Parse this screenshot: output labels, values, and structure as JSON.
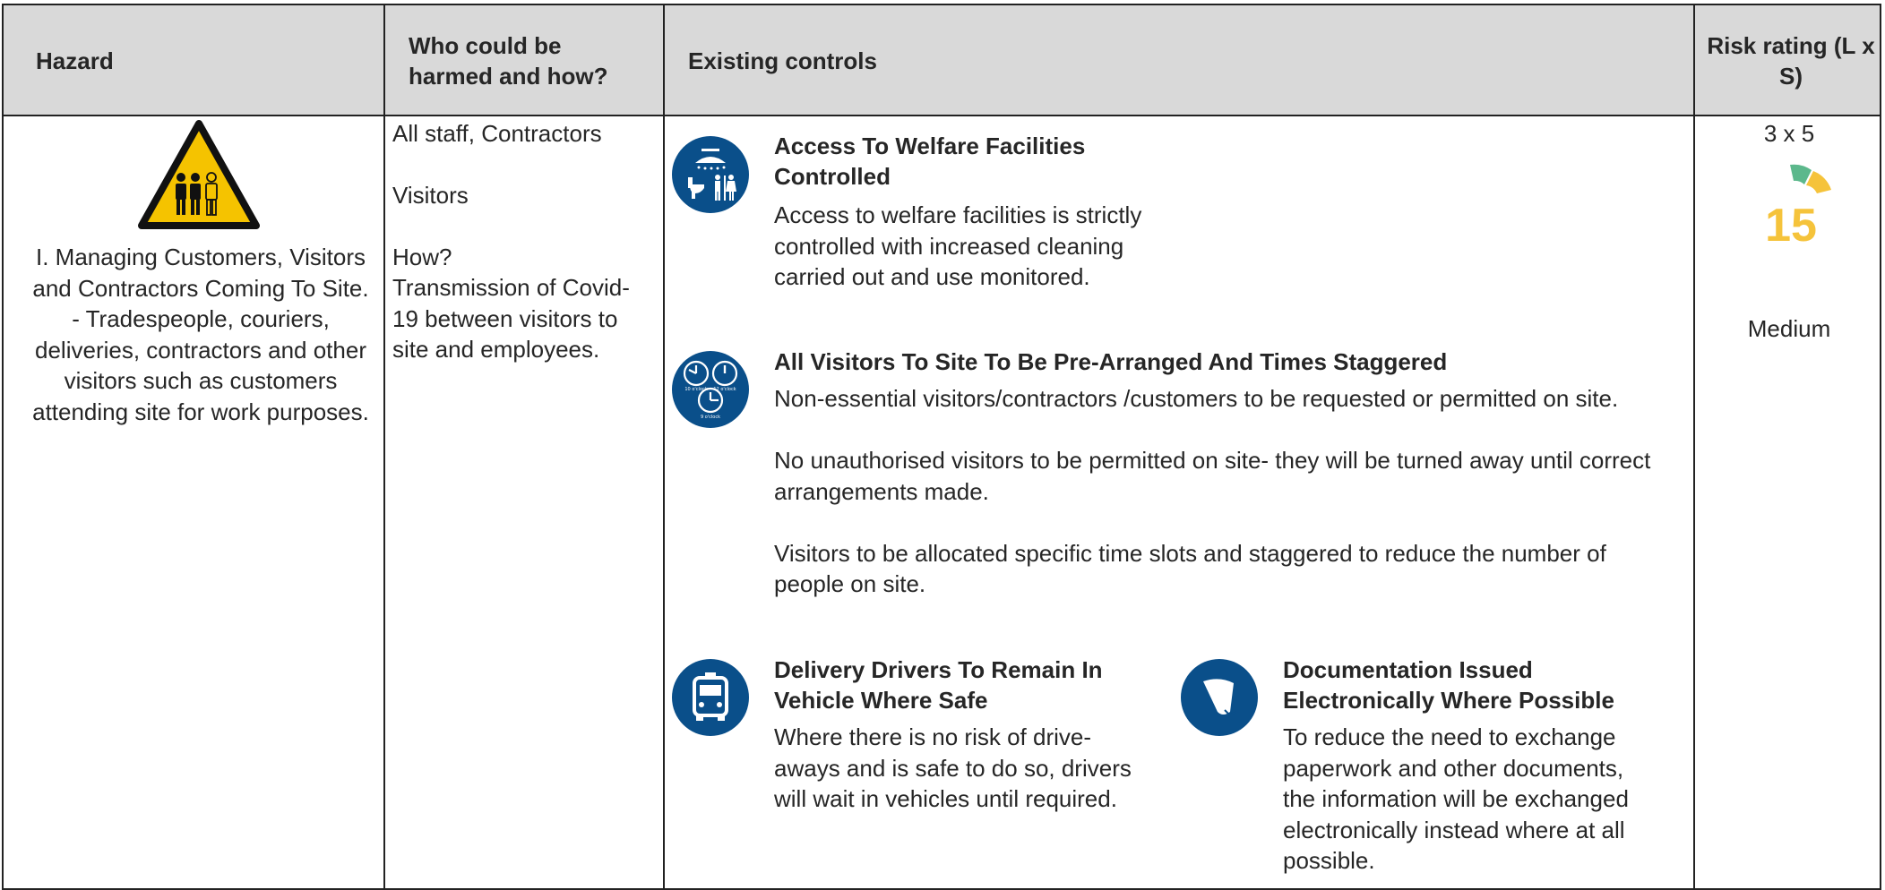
{
  "header": {
    "hazard": "Hazard",
    "who": "Who could be harmed and how?",
    "controls": "Existing controls",
    "risk": "Risk rating (L x S)"
  },
  "row": {
    "hazard_text": "I. Managing Customers, Visitors and Contractors Coming To Site.\n- Tradespeople, couriers, deliveries, contractors and other visitors such as customers attending site for work purposes.",
    "who": {
      "line1": "All staff, Contractors",
      "line2": "Visitors",
      "how_label": "How?",
      "how_text": "Transmission of Covid-19 between visitors to site and employees."
    },
    "controls": [
      {
        "icon": "welfare-facilities-icon",
        "title": "Access To Welfare Facilities Controlled",
        "body": "Access to welfare facilities is strictly controlled with increased cleaning carried out and use monitored."
      },
      {
        "icon": "staggered-clocks-icon",
        "title": "All Visitors To Site To Be Pre-Arranged And Times Staggered",
        "body": "Non-essential visitors/contractors /customers to be requested or permitted on site.\n\nNo unauthorised visitors to be permitted on site- they will be turned away until correct arrangements made.\n\nVisitors to be allocated specific time slots and staggered to reduce the number of people on site."
      },
      {
        "icon": "vehicle-icon",
        "title": "Delivery Drivers To Remain In Vehicle Where Safe",
        "body": "Where there is no risk of drive-aways and is safe to do so, drivers will wait in vehicles until required."
      },
      {
        "icon": "document-icon",
        "title": "Documentation Issued Electronically Where Possible",
        "body": "To reduce the need to exchange paperwork and other documents, the information will be exchanged electronically instead where at all possible."
      }
    ],
    "risk": {
      "calc": "3 x 5",
      "score": "15",
      "level": "Medium",
      "gauge_colors": [
        "#5cb88c",
        "#f5c33b"
      ]
    }
  }
}
